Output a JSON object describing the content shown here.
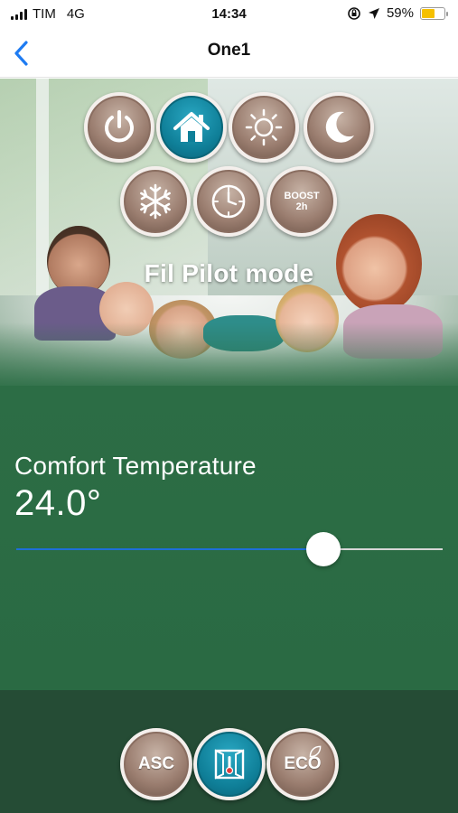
{
  "status_bar": {
    "carrier": "TIM",
    "network": "4G",
    "time": "14:34",
    "battery_text": "59%",
    "battery_level": 0.59,
    "battery_color": "#f5c000"
  },
  "nav": {
    "title": "One1",
    "back_icon": "chevron-left-icon"
  },
  "modes": [
    {
      "name": "power",
      "icon": "power-icon",
      "active": false
    },
    {
      "name": "comfort",
      "icon": "home-icon",
      "active": true
    },
    {
      "name": "day",
      "icon": "sun-icon",
      "active": false
    },
    {
      "name": "night",
      "icon": "moon-icon",
      "active": false
    },
    {
      "name": "antifreeze",
      "icon": "snowflake-icon",
      "active": false
    },
    {
      "name": "timer",
      "icon": "clock-icon",
      "active": false
    },
    {
      "name": "boost",
      "icon": "boost-icon",
      "label_line1": "BOOST",
      "label_line2": "2h",
      "active": false
    }
  ],
  "mode_label": "Fil Pilot mode",
  "temperature": {
    "title": "Comfort Temperature",
    "value": "24.0°",
    "slider_fraction": 0.72
  },
  "bottom": {
    "asc_label": "ASC",
    "eco_label": "ECO"
  },
  "colors": {
    "accent_blue": "#1e6fd8",
    "active_teal": "#0f7f98",
    "green": "#2c6d45"
  }
}
